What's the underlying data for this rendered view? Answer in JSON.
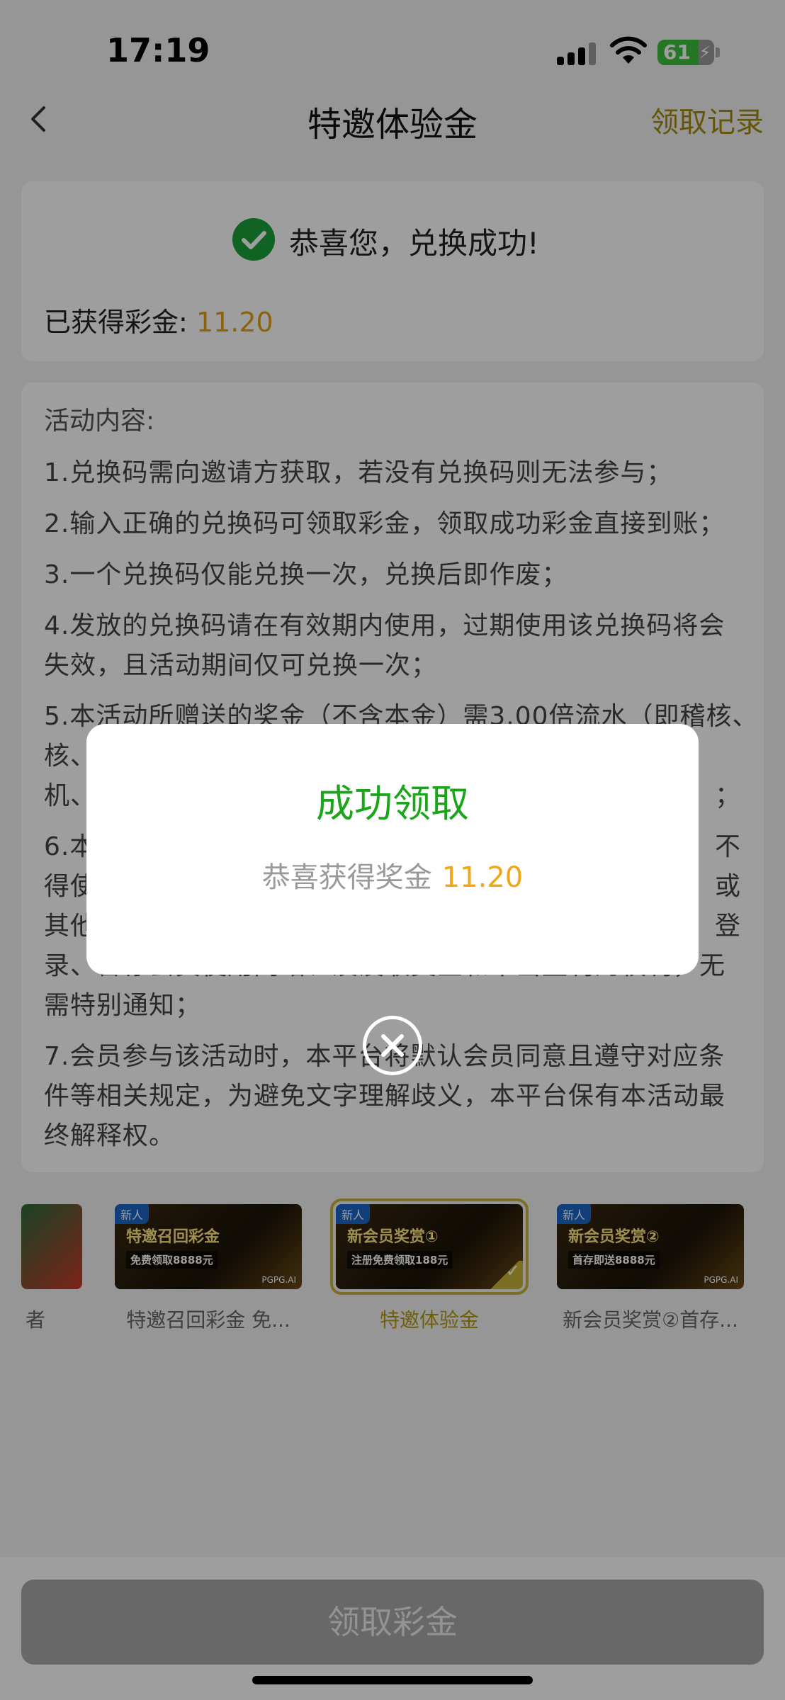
{
  "status_bar": {
    "time": "17:19",
    "battery": "61"
  },
  "nav": {
    "title": "特邀体验金",
    "right_link": "领取记录"
  },
  "success_card": {
    "message": "恭喜您，兑换成功!",
    "earned_label": "已获得彩金:",
    "earned_value": "11.20"
  },
  "rules": {
    "title": "活动内容:",
    "items": [
      "1.兑换码需向邀请方获取，若没有兑换码则无法参与；",
      "2.输入正确的兑换码可领取彩金，领取成功彩金直接到账；",
      "3.一个兑换码仅能兑换一次，兑换后即作废；",
      "4.发放的兑换码请在有效期内使用，过期使用该兑换码将会失效，且活动期间仅可兑换一次；",
      "5.本活动所赠送的奖金（不含本金）需3.00倍流水（即稽核、",
      "6.本",
      "7.会员参与该活动时，本平台将默认会员同意且遵守对应条件等相关规定，为避免文字理解歧义，本平台保有本活动最终解释权。"
    ],
    "item5_line2_left": "核、",
    "item5_line3_left": "机、",
    "item5_line3_right": "；",
    "item6_line2_left": "得使",
    "item6_line2_right": "或",
    "item6_line3_left": "其他",
    "item6_line3_right": "登",
    "item6_line1_right": "不",
    "item6_line4": "录、冒存会员使用网站、及没收奖金和不当盈利的权利，无",
    "item6_line5": "需特别通知；"
  },
  "tabs": [
    {
      "label": "者",
      "tag": "",
      "banner": "",
      "sub": ""
    },
    {
      "label": "特邀召回彩金 免...",
      "tag": "新人",
      "banner": "特邀召回彩金",
      "sub": "免费领取8888元"
    },
    {
      "label": "特邀体验金",
      "tag": "新人",
      "banner": "新会员奖赏①",
      "sub": "注册免费领取188元"
    },
    {
      "label": "新会员奖赏②首存...",
      "tag": "新人",
      "banner": "新会员奖赏②",
      "sub": "首存即送8888元"
    }
  ],
  "tab_brand": "PGPG.AI",
  "claim_button": "领取彩金",
  "modal": {
    "title": "成功领取",
    "body_label": "恭喜获得奖金",
    "body_value": "11.20"
  },
  "colors": {
    "accent": "#b49a14",
    "success": "#1aa51a",
    "amount": "#f0a616"
  }
}
